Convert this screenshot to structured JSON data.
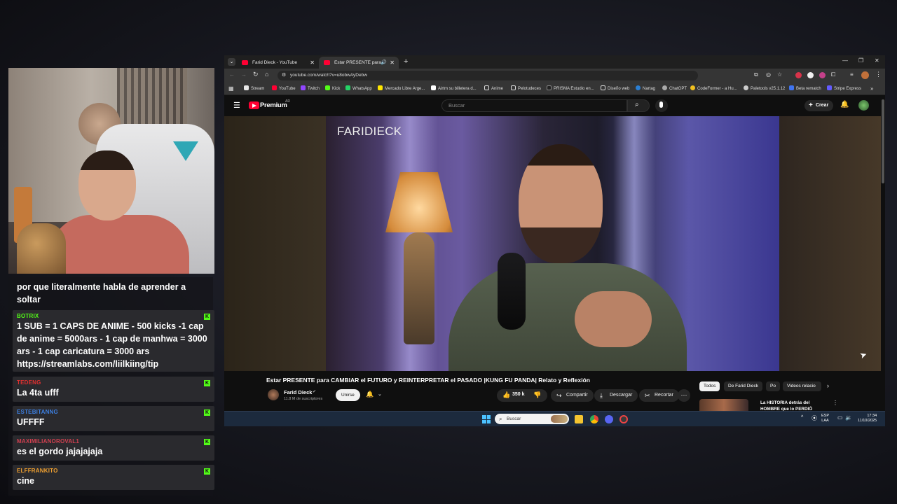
{
  "chat": {
    "messages": [
      {
        "user": "",
        "text": "por que literalmente habla de aprender a soltar",
        "color": "#ffffff"
      },
      {
        "user": "BOTRIX",
        "text": "1 SUB = 1 CAPS DE ANIME - 500 kicks -1 cap de anime = 5000ars - 1 cap de manhwa = 3000 ars - 1 cap caricatura = 3000 ars https://streamlabs.com/liilkiing/tip",
        "color": "#53fc18"
      },
      {
        "user": "TEDENG",
        "text": "La 4ta ufff",
        "color": "#e03030"
      },
      {
        "user": "ESTEBITANNG",
        "text": "UFFFF",
        "color": "#3d7fe0"
      },
      {
        "user": "MAXIMILIANOROVAL1",
        "text": "es el gordo jajajajaja",
        "color": "#d04050"
      },
      {
        "user": "ELFFRANKITO",
        "text": "cine",
        "color": "#f0a030"
      }
    ],
    "badge": "K"
  },
  "browser": {
    "tabs": [
      {
        "title": "Farid Dieck - YouTube",
        "active": false
      },
      {
        "title": "Estar PRESENTE para CAMB",
        "active": true
      }
    ],
    "new_tab": "+",
    "url": "youtube.com/watch?v=u8obwAyDebw",
    "bookmarks": [
      {
        "label": "Stream",
        "color": "#e8e8e8"
      },
      {
        "label": "YouTube",
        "color": "#ff0033"
      },
      {
        "label": "Twitch",
        "color": "#9146ff"
      },
      {
        "label": "Kick",
        "color": "#53fc18"
      },
      {
        "label": "WhatsApp",
        "color": "#25d366"
      },
      {
        "label": "Mercado Libre Arge...",
        "color": "#ffe600"
      },
      {
        "label": "Airtm su billetera d...",
        "color": "#ffffff"
      },
      {
        "label": "Anime",
        "color": "#e8e8e8"
      },
      {
        "label": "Pelotudeces",
        "color": "#e8e8e8"
      },
      {
        "label": "PRISMA Estudio en...",
        "color": "#222222"
      },
      {
        "label": "Diseño web",
        "color": "#e8e8e8"
      },
      {
        "label": "Nartag",
        "color": "#2a7fd4"
      },
      {
        "label": "ChatGPT",
        "color": "#aaaaaa"
      },
      {
        "label": "CodeFormer - a Hu...",
        "color": "#f0c020"
      },
      {
        "label": "Paletools v25.1.12",
        "color": "#cccccc"
      },
      {
        "label": "Beta rematch",
        "color": "#3f74f0"
      },
      {
        "label": "Stripe Express",
        "color": "#635bff"
      }
    ]
  },
  "youtube": {
    "logo": "Premium",
    "region": "AR",
    "search_placeholder": "Buscar",
    "create_label": "Crear",
    "video_watermark": "FARIDIECK",
    "video_title": "Estar PRESENTE para CAMBIAR el FUTURO y REINTERPRETAR el PASADO |KUNG FU PANDA| Relato y Reflexión",
    "channel_name": "Farid Dieck",
    "subscribers": "11.8 M de suscriptores",
    "join_label": "Unirse",
    "likes": "350 k",
    "share_label": "Compartir",
    "download_label": "Descargar",
    "clip_label": "Recortar",
    "chips": [
      "Todos",
      "De Farid Dieck",
      "Po",
      "Videos relacio"
    ],
    "related_title": "La HISTORIA detrás del HOMBRE que lo PERDIÓ TODO"
  },
  "taskbar": {
    "search_placeholder": "Buscar",
    "lang": "ESP",
    "lang2": "LAA",
    "time": "17:34",
    "date": "11/10/2025"
  }
}
